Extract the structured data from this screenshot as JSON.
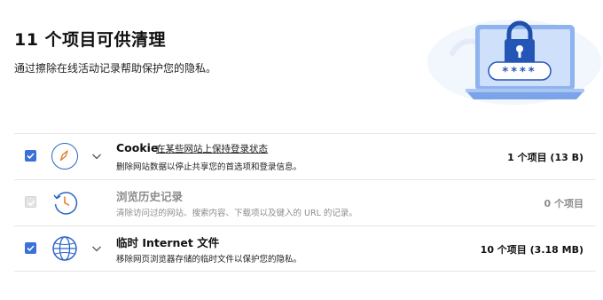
{
  "header": {
    "title": "11 个项目可供清理",
    "subtitle": "通过擦除在线活动记录帮助保护您的隐私。"
  },
  "illustration": {
    "password_mask": "****"
  },
  "colors": {
    "accent": "#3b6fd9",
    "icon_blue": "#2f65c8",
    "disabled_text": "#8c8c8c",
    "laptop_screen": "#cfe0fb"
  },
  "items": [
    {
      "title": "Cookie",
      "link": "在某些网站上保持登录状态",
      "description": "删除网站数据以停止共享您的首选项和登录信息。",
      "count": "1 个项目 (13 B)",
      "checked": true,
      "enabled": true,
      "icon": "compass-icon"
    },
    {
      "title": "浏览历史记录",
      "description": "清除访问过的网站、搜索内容、下载项以及键入的 URL 的记录。",
      "count": "0 个项目",
      "checked": false,
      "enabled": false,
      "icon": "history-clock-icon"
    },
    {
      "title": "临时 Internet 文件",
      "description": "移除网页浏览器存储的临时文件以保护您的隐私。",
      "count": "10 个项目 (3.18 MB)",
      "checked": true,
      "enabled": true,
      "icon": "globe-icon"
    }
  ]
}
